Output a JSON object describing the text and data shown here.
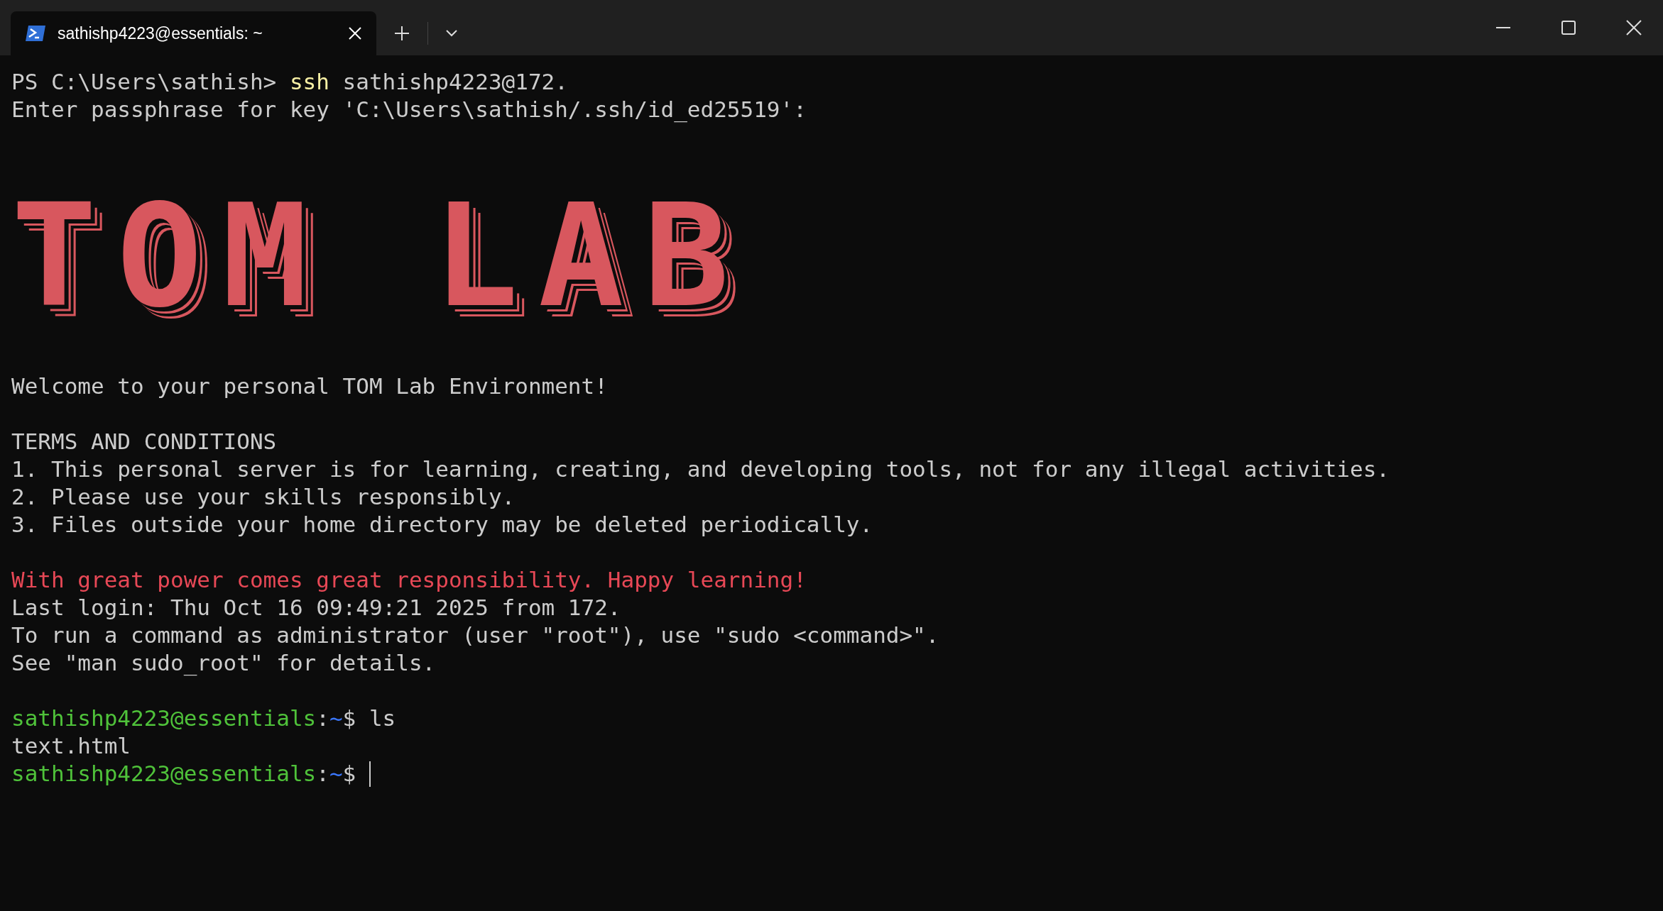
{
  "tab": {
    "title": "sathishp4223@essentials: ~",
    "selected": true
  },
  "lines": [
    {
      "kind": "command",
      "prompt": "PS C:\\Users\\sathish>",
      "program": "ssh",
      "args": "sathishp4223@172."
    },
    {
      "kind": "text",
      "text": "Enter passphrase for key 'C:\\Users\\sathish/.ssh/id_ed25519':"
    },
    {
      "kind": "banner",
      "text": "TOM LAB"
    },
    {
      "kind": "text",
      "text": "Welcome to your personal TOM Lab Environment!"
    },
    {
      "kind": "blank"
    },
    {
      "kind": "text",
      "text": "TERMS AND CONDITIONS"
    },
    {
      "kind": "text",
      "text": "1. This personal server is for learning, creating, and developing tools, not for any illegal activities."
    },
    {
      "kind": "text",
      "text": "2. Please use your skills responsibly."
    },
    {
      "kind": "text",
      "text": "3. Files outside your home directory may be deleted periodically."
    },
    {
      "kind": "blank"
    },
    {
      "kind": "alert",
      "text": "With great power comes great responsibility. Happy learning!"
    },
    {
      "kind": "text",
      "text": "Last login: Thu Oct 16 09:49:21 2025 from 172."
    },
    {
      "kind": "text",
      "text": "To run a command as administrator (user \"root\"), use \"sudo <command>\"."
    },
    {
      "kind": "text",
      "text": "See \"man sudo_root\" for details."
    },
    {
      "kind": "blank"
    },
    {
      "kind": "prompt",
      "user": "sathishp4223@essentials",
      "sep": ":",
      "path": "~",
      "symbol": "$",
      "command": "ls",
      "cursor": false
    },
    {
      "kind": "text",
      "text": "text.html"
    },
    {
      "kind": "prompt",
      "user": "sathishp4223@essentials",
      "sep": ":",
      "path": "~",
      "symbol": "$",
      "cursor": true
    }
  ]
}
